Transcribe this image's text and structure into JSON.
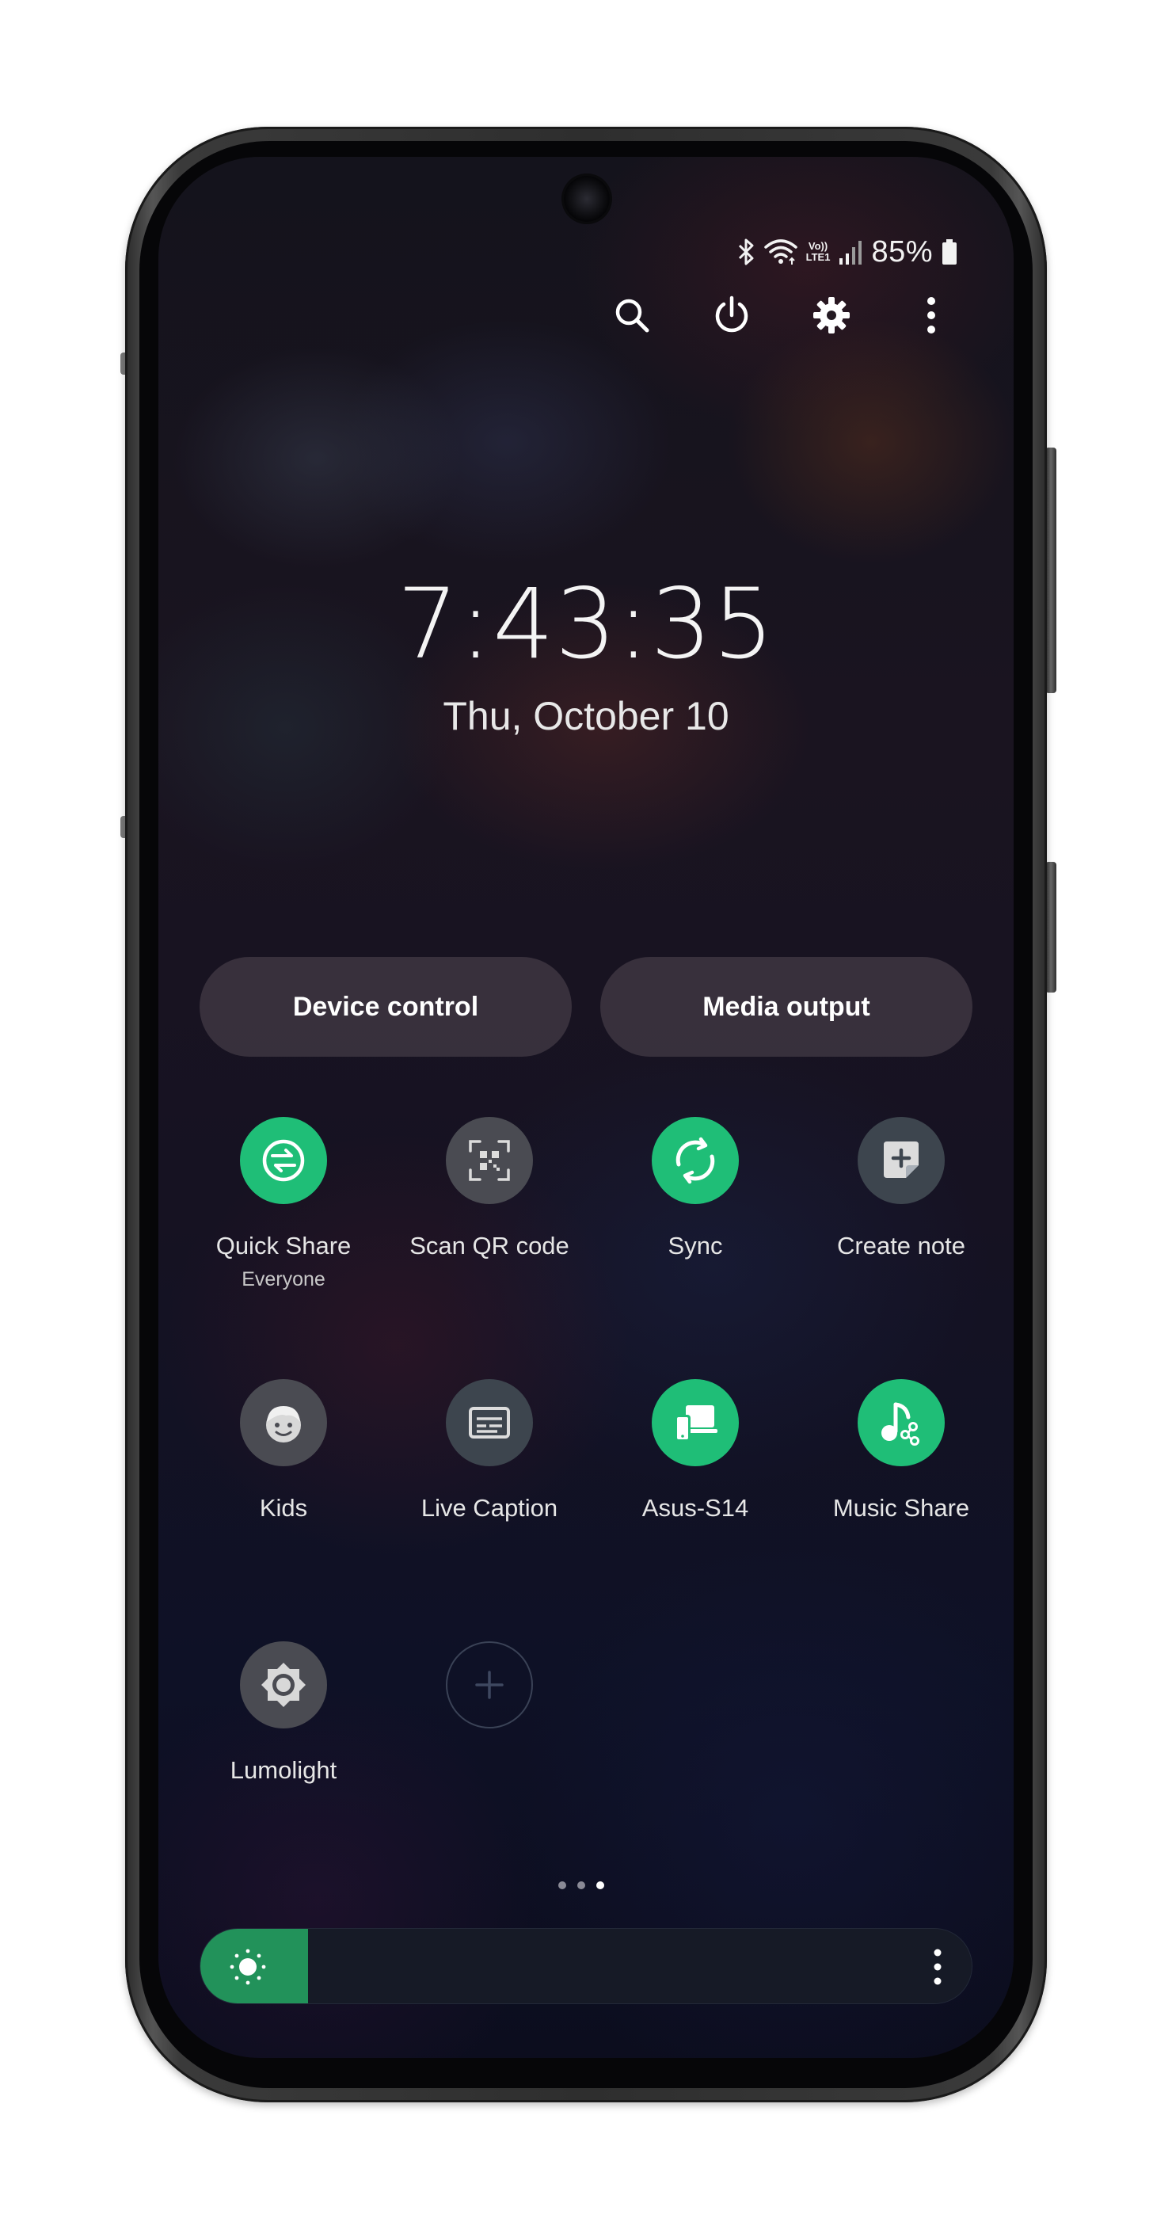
{
  "status_bar": {
    "lte_top": "Vo))",
    "lte_bottom": "LTE1",
    "battery": "85%"
  },
  "top_actions": [
    {
      "icon": "search-icon"
    },
    {
      "icon": "power-icon"
    },
    {
      "icon": "gear-icon"
    },
    {
      "icon": "more-vertical-icon"
    }
  ],
  "clock": {
    "time": "7:43:35",
    "date": "Thu, October 10"
  },
  "pills": {
    "device_control": "Device control",
    "media_output": "Media output"
  },
  "tiles": {
    "quick_share": {
      "label": "Quick Share",
      "sub": "Everyone",
      "state": "on"
    },
    "scan_qr": {
      "label": "Scan QR code",
      "state": "off"
    },
    "sync": {
      "label": "Sync",
      "state": "on"
    },
    "create_note": {
      "label": "Create note",
      "state": "off"
    },
    "kids": {
      "label": "Kids",
      "state": "off"
    },
    "live_caption": {
      "label": "Live Caption",
      "state": "off"
    },
    "asus": {
      "label": "Asus-S14",
      "state": "on"
    },
    "music_share": {
      "label": "Music Share",
      "state": "on"
    },
    "lumolight": {
      "label": "Lumolight",
      "state": "off"
    }
  },
  "pager": {
    "pages": 3,
    "active": 3
  },
  "brightness": {
    "level": 0.14
  },
  "colors": {
    "tile_on": "#1fbe77",
    "tile_off": "#4a4b52",
    "brightness_fill": "#22925a"
  }
}
